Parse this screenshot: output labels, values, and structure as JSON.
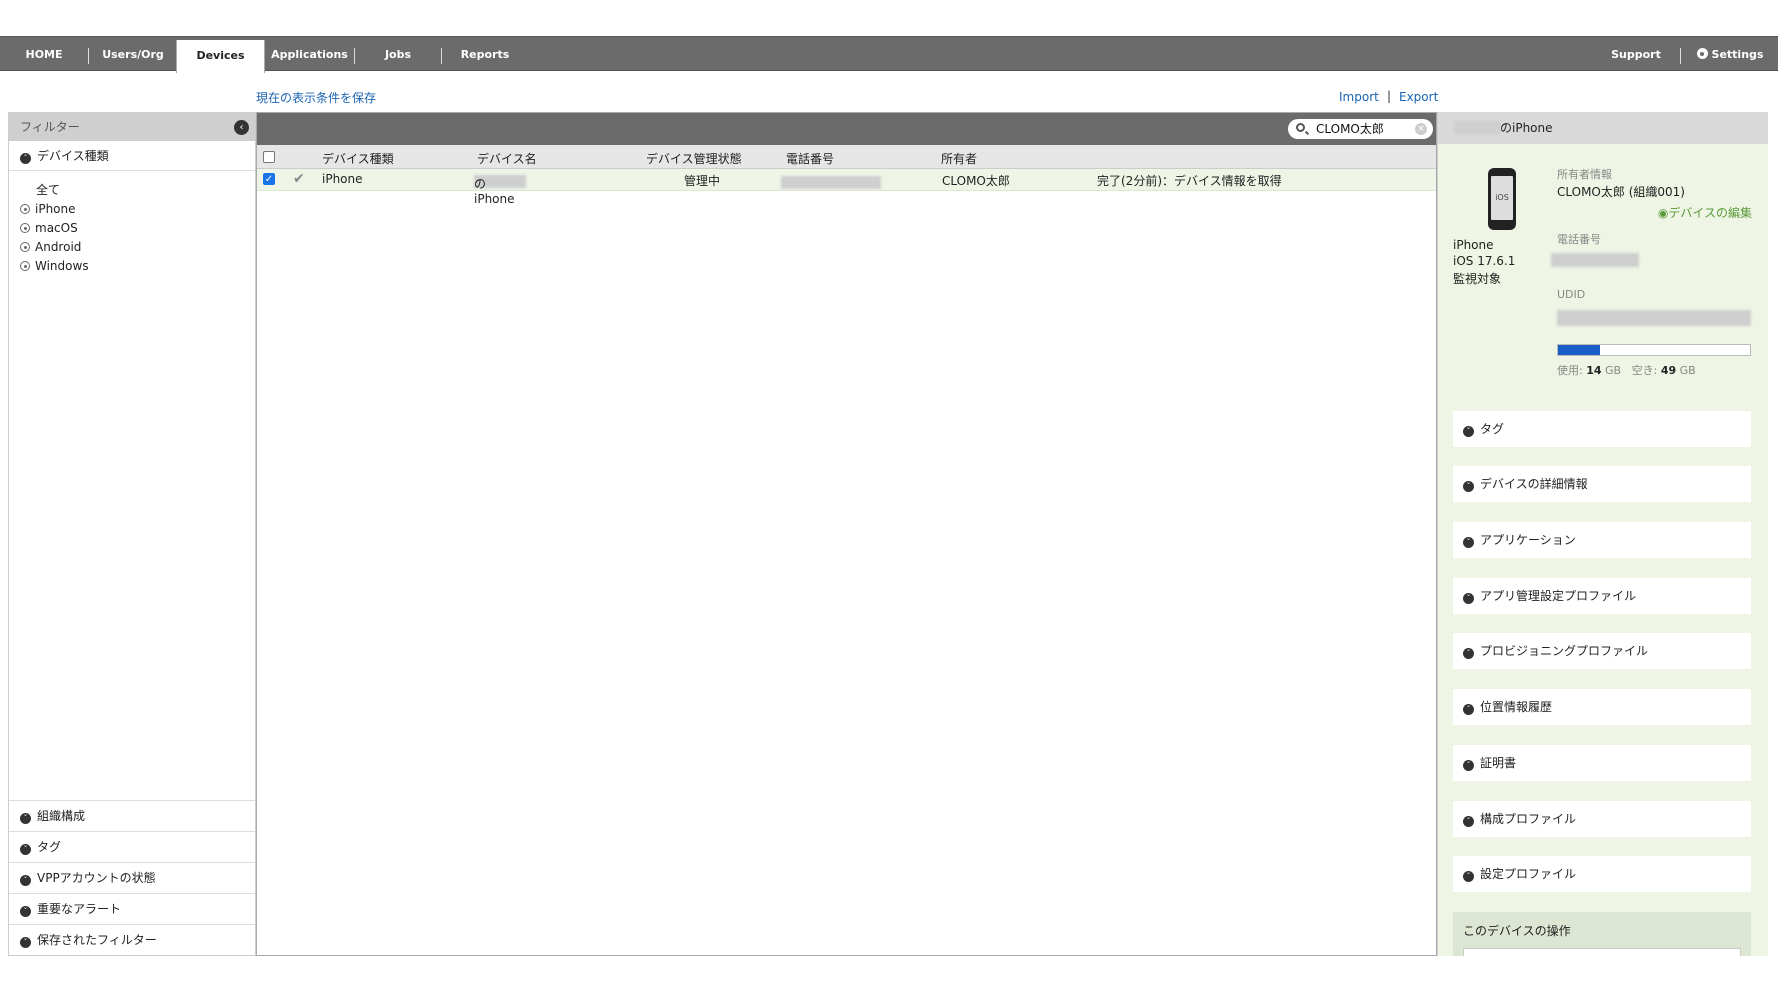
{
  "nav": {
    "tabs": [
      "HOME",
      "Users/Org",
      "Devices",
      "Applications",
      "Jobs",
      "Reports"
    ],
    "active": "Devices",
    "support": "Support",
    "settings": "Settings"
  },
  "links": {
    "save_view": "現在の表示条件を保存",
    "import": "Import",
    "sep": "|",
    "export": "Export"
  },
  "filter": {
    "title": "フィルター",
    "device_type_section": "デバイス種類",
    "device_types": [
      "全て",
      "iPhone",
      "macOS",
      "Android",
      "Windows"
    ],
    "bottom_sections": [
      "組織構成",
      "タグ",
      "VPPアカウントの状態",
      "重要なアラート",
      "保存されたフィルター"
    ]
  },
  "search": {
    "value": "CLOMO太郎"
  },
  "table": {
    "headers": [
      "デバイス種類",
      "デバイス名",
      "デバイス管理状態",
      "電話番号",
      "所有者"
    ],
    "rows": [
      {
        "type": "iPhone",
        "name_suffix": "のiPhone",
        "status": "管理中",
        "owner": "CLOMO太郎",
        "job": "完了(2分前)：デバイス情報を取得"
      }
    ]
  },
  "detail": {
    "title_suffix": "のiPhone",
    "phone_screen_label": "iOS",
    "device_model": "iPhone",
    "os_version": "iOS 17.6.1",
    "supervised": "監視対象",
    "owner_label": "所有者情報",
    "owner_value": "CLOMO太郎 (組織001)",
    "edit_link": "デバイスの編集",
    "phone_label": "電話番号",
    "udid_label": "UDID",
    "storage": {
      "used_label": "使用:",
      "used": "14",
      "free_label": "空き:",
      "free": "49",
      "unit": "GB",
      "used_fraction": 0.22
    },
    "sections": [
      "タグ",
      "デバイスの詳細情報",
      "アプリケーション",
      "アプリ管理設定プロファイル",
      "プロビジョニングプロファイル",
      "位置情報履歴",
      "証明書",
      "構成プロファイル",
      "設定プロファイル"
    ],
    "ops_title": "このデバイスの操作"
  }
}
